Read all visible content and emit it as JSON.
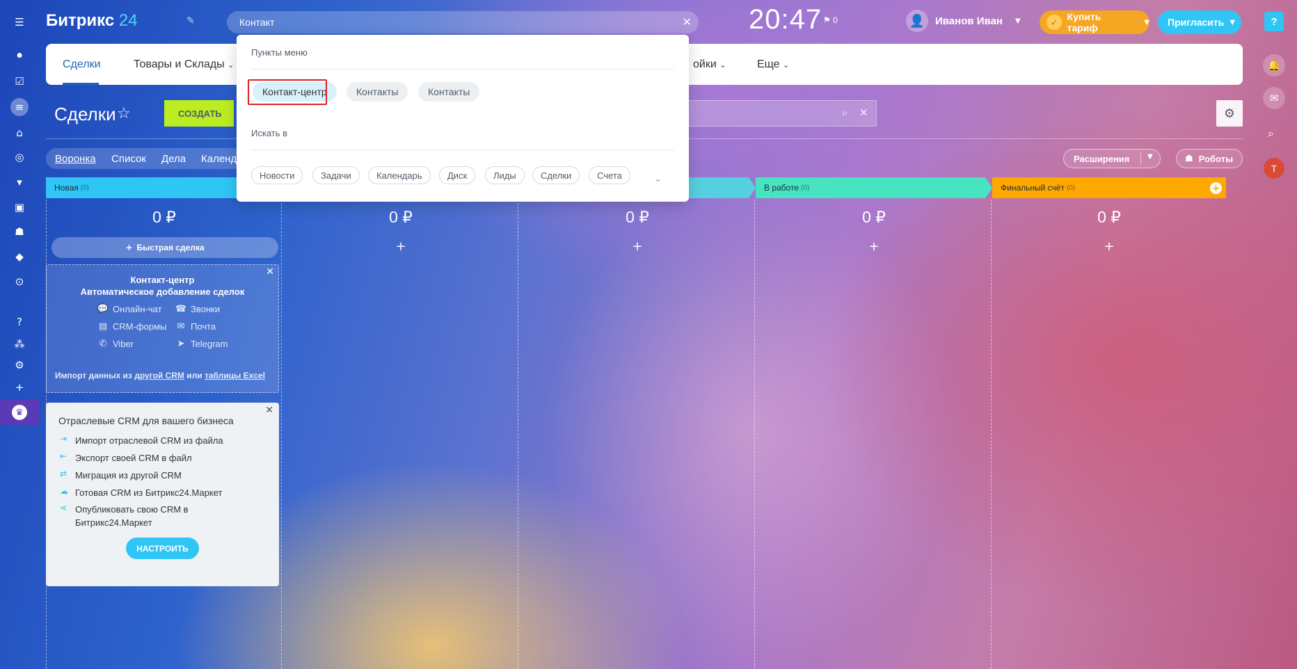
{
  "app": {
    "logo_name": "Битрикс",
    "logo_num": "24",
    "search_value": "Контакт",
    "clock": "20:47",
    "flag_count": "0",
    "user_name": "Иванов Иван",
    "buy_label": "Купить тариф",
    "invite_label": "Пригласить",
    "help_label": "?",
    "right_avatar": "Т"
  },
  "nav": {
    "items": [
      "Сделки",
      "Товары и Склады",
      "ойки",
      "Еще"
    ]
  },
  "title_row": {
    "title": "Сделки",
    "create_label": "СОЗДАТЬ"
  },
  "view_tabs": [
    "Воронка",
    "Список",
    "Дела",
    "Календ"
  ],
  "toolbar": {
    "extensions_label": "Расширения",
    "robots_label": "Роботы"
  },
  "columns": [
    {
      "name": "Новая",
      "count": "(0)",
      "sum": "0 ₽",
      "color": "#2fc6f6"
    },
    {
      "name": "",
      "count": "",
      "sum": "0 ₽",
      "color": "#2fc6f6"
    },
    {
      "name": "",
      "count": "",
      "sum": "0 ₽",
      "color": "#55d0e0"
    },
    {
      "name": "В работе",
      "count": "(0)",
      "sum": "0 ₽",
      "color": "#47e4c2"
    },
    {
      "name": "Финальный счёт",
      "count": "(0)",
      "sum": "0 ₽",
      "color": "#ffa900"
    }
  ],
  "quick_deal_label": "Быстрая сделка",
  "contact_center": {
    "title1": "Контакт-центр",
    "title2": "Автоматическое добавление сделок",
    "items": [
      "Онлайн-чат",
      "Звонки",
      "CRM-формы",
      "Почта",
      "Viber",
      "Telegram"
    ],
    "import_prefix": "Импорт данных из",
    "import_link1": "другой CRM",
    "import_or": "или",
    "import_link2": "таблицы Excel"
  },
  "industry_crm": {
    "title": "Отраслевые CRM для вашего бизнеса",
    "items": [
      "Импорт отраслевой CRM из файла",
      "Экспорт своей CRM в файл",
      "Миграция из другой CRM",
      "Готовая CRM из Битрикс24.Маркет",
      "Опубликовать свою CRM в Битрикс24.Маркет"
    ],
    "button": "НАСТРОИТЬ"
  },
  "dropdown": {
    "menu_heading": "Пункты меню",
    "menu_items": [
      "Контакт-центр",
      "Контакты",
      "Контакты"
    ],
    "search_heading": "Искать в",
    "search_items": [
      "Новости",
      "Задачи",
      "Календарь",
      "Диск",
      "Лиды",
      "Сделки",
      "Счета"
    ]
  }
}
